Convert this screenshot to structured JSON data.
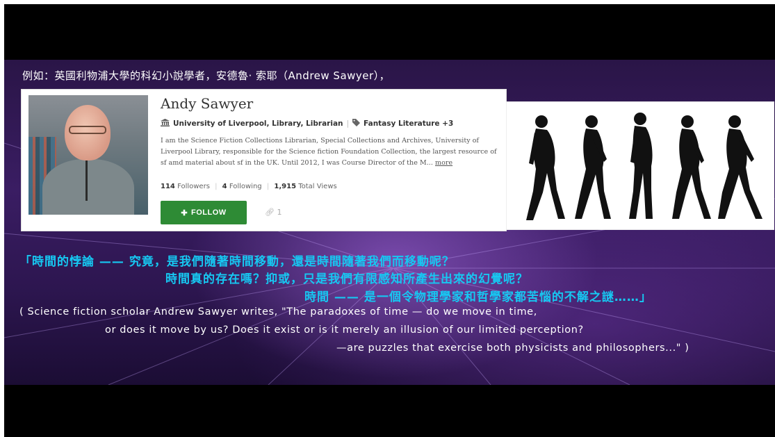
{
  "top_caption": "例如：英國利物浦大學的科幻小說學者，安德魯· 索耶（Andrew Sawyer），",
  "profile": {
    "name": "Andy Sawyer",
    "affiliation": "University of Liverpool, Library, Librarian",
    "interests": "Fantasy Literature +3",
    "bio": "I am the Science Fiction Collections Librarian, Special Collections and Archives, University of Liverpool Library, responsible for the Science fiction Foundation Collection, the largest resource of sf amd material about sf in the UK. Until 2012, I was Course Director of the M...",
    "more_label": "more",
    "followers_count": "114",
    "followers_label": "Followers",
    "following_count": "4",
    "following_label": "Following",
    "views_count": "1,915",
    "views_label": "Total Views",
    "follow_label": "FOLLOW",
    "link_count": "1"
  },
  "quote_zh": {
    "line1": "「時間的悖論 —— 究竟，是我們隨著時間移動，還是時間隨著我們而移動呢？",
    "line2": "時間真的存在嗎？抑或，只是我們有限感知所產生出來的幻覺呢？",
    "line3": "時間 —— 是一個令物理學家和哲學家都苦惱的不解之謎……」"
  },
  "quote_en": {
    "line1": "( Science fiction scholar Andrew Sawyer writes, \"The paradoxes of time — do we move in time,",
    "line2": "or does it move by us? Does it exist or is it merely an illusion of our limited perception?",
    "line3": "—are puzzles that exercise both physicists and philosophers...\" )"
  },
  "colors": {
    "accent_zh": "#16c8f2",
    "follow_green": "#2e8b35"
  }
}
